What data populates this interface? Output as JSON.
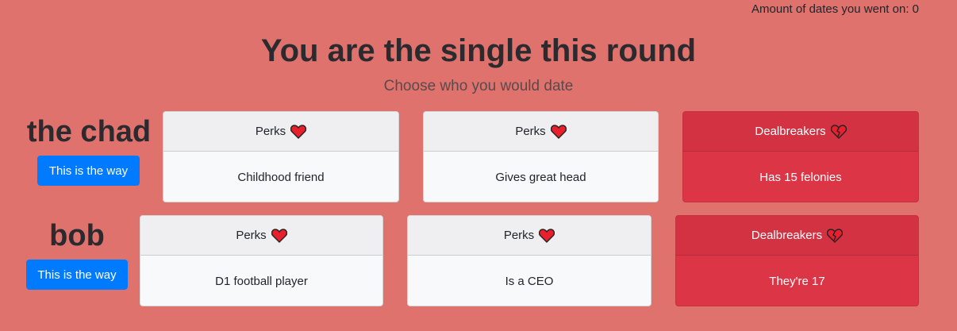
{
  "counter_text": "Amount of dates you went on: 0",
  "title": "You are the single this round",
  "subtitle": "Choose who you would date",
  "choose_button_label": "This is the way",
  "people": [
    {
      "name": "the chad",
      "cards": [
        {
          "type": "perk",
          "header": "Perks",
          "icon": "heart-icon",
          "body": "Childhood friend"
        },
        {
          "type": "perk",
          "header": "Perks",
          "icon": "heart-icon",
          "body": "Gives great head"
        },
        {
          "type": "dealbreaker",
          "header": "Dealbreakers",
          "icon": "broken-heart-icon",
          "body": "Has 15 felonies"
        }
      ]
    },
    {
      "name": "bob",
      "cards": [
        {
          "type": "perk",
          "header": "Perks",
          "icon": "heart-icon",
          "body": "D1 football player"
        },
        {
          "type": "perk",
          "header": "Perks",
          "icon": "heart-icon",
          "body": "Is a CEO"
        },
        {
          "type": "dealbreaker",
          "header": "Dealbreakers",
          "icon": "broken-heart-icon",
          "body": "They're 17"
        }
      ]
    }
  ],
  "colors": {
    "background": "#e0726d",
    "button": "#007bff",
    "dealbreaker": "#dc3545",
    "perk_card": "#f8f9fa",
    "heart": "#e8202e"
  }
}
